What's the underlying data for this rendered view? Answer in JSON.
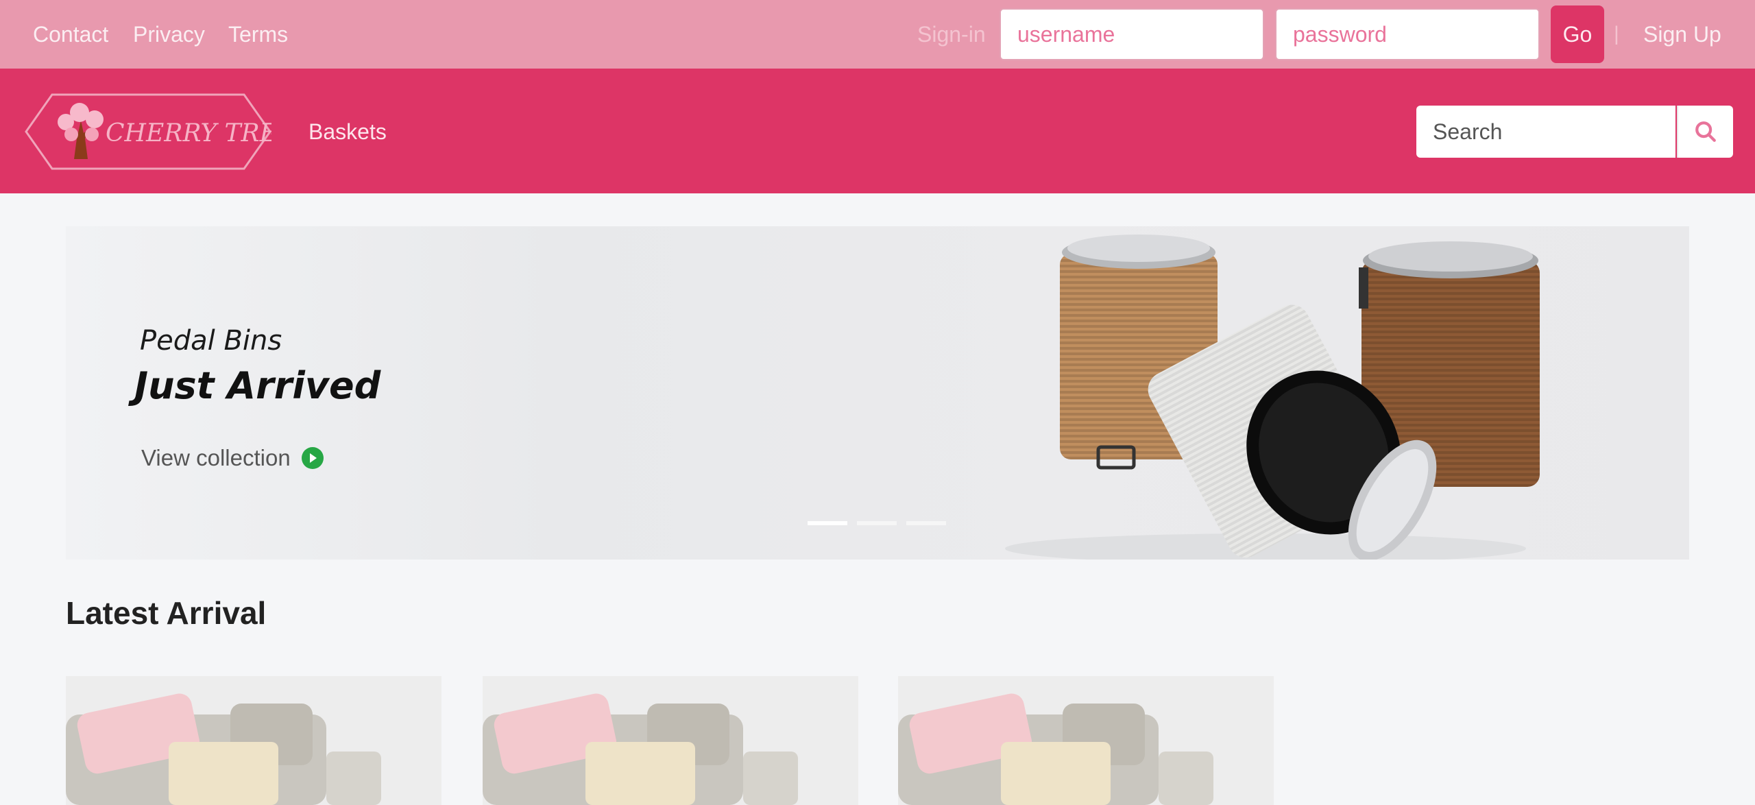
{
  "topbar": {
    "links": [
      "Contact",
      "Privacy",
      "Terms"
    ],
    "signin_label": "Sign-in",
    "username_placeholder": "username",
    "password_placeholder": "password",
    "go_label": "Go",
    "divider": "|",
    "signup_label": "Sign Up"
  },
  "navbar": {
    "logo_text": "CHERRY TREE",
    "nav_items": [
      "Baskets"
    ],
    "search_placeholder": "Search",
    "search_icon": "search-icon"
  },
  "hero": {
    "subtitle": "Pedal Bins",
    "title": "Just Arrived",
    "cta_label": "View collection",
    "cta_icon": "play-circle-icon",
    "slide_count": 3,
    "active_slide": 1
  },
  "latest": {
    "title": "Latest Arrival",
    "products": [
      {
        "image": "sofa-cushions-throw"
      },
      {
        "image": "sofa-cushions-throw"
      },
      {
        "image": "sofa-cushions-throw"
      }
    ]
  },
  "colors": {
    "topbar_bg": "#e899ae",
    "navbar_bg": "#dd3566",
    "accent": "#dd3566",
    "cta_green": "#27a745",
    "page_bg": "#f5f6f8"
  }
}
